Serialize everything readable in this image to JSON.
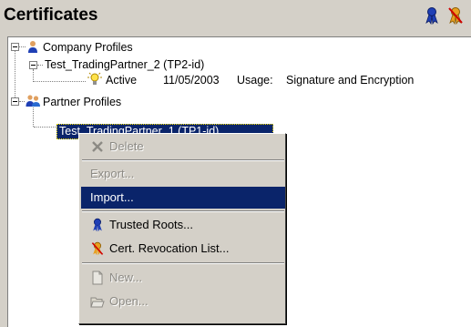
{
  "header": {
    "title": "Certificates",
    "icons": [
      "trusted-roots-icon",
      "revocation-list-icon"
    ]
  },
  "tree": {
    "company_profiles": "Company Profiles",
    "partner_tp2": "Test_TradingPartner_2 (TP2-id)",
    "cert_status": "Active",
    "cert_date": "11/05/2003",
    "cert_usage_label": "Usage:",
    "cert_usage": "Signature and Encryption",
    "partner_profiles": "Partner Profiles",
    "partner_tp1": "Test_TradingPartner_1 (TP1-id)"
  },
  "context_menu": {
    "delete": "Delete",
    "export": "Export...",
    "import": "Import...",
    "trusted_roots": "Trusted Roots...",
    "revocation_list": "Cert. Revocation List...",
    "new": "New...",
    "open": "Open..."
  },
  "colors": {
    "selection": "#0a246a",
    "panel_bg": "#d4d0c8",
    "disabled_text": "#8c8a84"
  }
}
